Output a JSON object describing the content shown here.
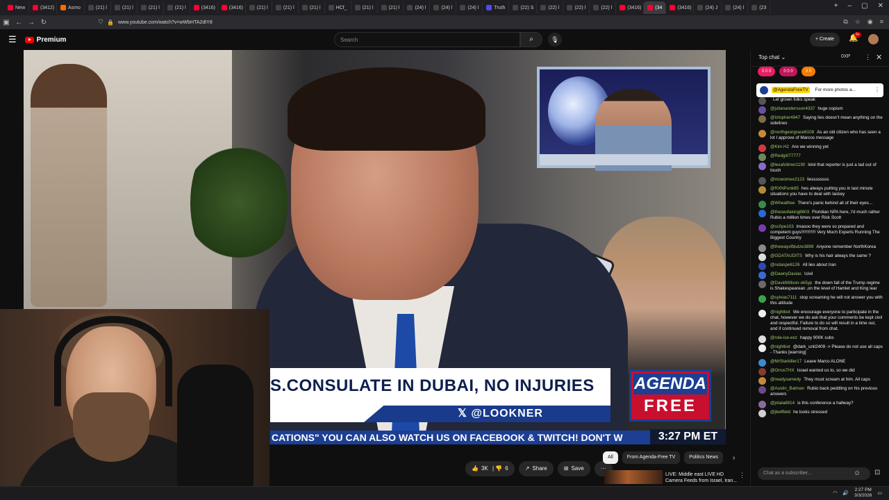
{
  "browser": {
    "tabs": [
      {
        "label": "New",
        "color": "#ff0033"
      },
      {
        "label": "(3412)",
        "color": "#ff0033"
      },
      {
        "label": "Asmo",
        "color": "#ff6b00"
      },
      {
        "label": "(21) l",
        "color": "#444"
      },
      {
        "label": "(21) l",
        "color": "#444"
      },
      {
        "label": "(21) l",
        "color": "#444"
      },
      {
        "label": "(21) l",
        "color": "#444"
      },
      {
        "label": "(3416)",
        "color": "#ff0033"
      },
      {
        "label": "(3416)",
        "color": "#ff0033"
      },
      {
        "label": "(21) l",
        "color": "#444"
      },
      {
        "label": "(21) l",
        "color": "#444"
      },
      {
        "label": "(21) l",
        "color": "#444"
      },
      {
        "label": "HCf_",
        "color": "#444"
      },
      {
        "label": "(21) l",
        "color": "#444"
      },
      {
        "label": "(21) l",
        "color": "#444"
      },
      {
        "label": "(24) l",
        "color": "#444"
      },
      {
        "label": "(24) l",
        "color": "#444"
      },
      {
        "label": "(24) l",
        "color": "#444"
      },
      {
        "label": "Truth",
        "color": "#5448ee"
      },
      {
        "label": "(22) S",
        "color": "#444"
      },
      {
        "label": "(22) l",
        "color": "#444"
      },
      {
        "label": "(22) l",
        "color": "#444"
      },
      {
        "label": "(22) l",
        "color": "#444"
      },
      {
        "label": "(3416)",
        "color": "#ff0033"
      },
      {
        "label": "(34",
        "color": "#ff0033"
      },
      {
        "label": "(3416)",
        "color": "#ff0033"
      },
      {
        "label": "(24) J",
        "color": "#444"
      },
      {
        "label": "(24) l",
        "color": "#444"
      },
      {
        "label": "(23",
        "color": "#444"
      }
    ],
    "active_tab_index": 24,
    "url": "www.youtube.com/watch?v=wWbHTA2dtY8"
  },
  "youtube": {
    "logo": "Premium",
    "search_placeholder": "Search",
    "create_label": "Create",
    "notifications": "9+"
  },
  "video": {
    "headline": "S.CONSULATE IN DUBAI, NO INJURIES",
    "handle": "@LOOKNER",
    "logo_top": "AGENDA",
    "logo_bottom": "FREE",
    "ticker": "CATIONS\"   YOU CAN ALSO WATCH US ON FACEBOOK & TWITCH!   DON'T W",
    "clock": "3:27 PM ET"
  },
  "actions": {
    "likes": "3K",
    "dislikes": "6",
    "share": "Share",
    "save": "Save"
  },
  "chips": [
    "All",
    "From Agenda-Free TV",
    "Politics News"
  ],
  "recommendation": {
    "title": "LIVE: Middle east LIVE HD Camera Feeds from Israel, Iran..."
  },
  "chat": {
    "title": "Top chat",
    "xp": "0XP",
    "tickers": [
      {
        "label": "0  0  0",
        "color": "#e91e63"
      },
      {
        "label": "0  0  0",
        "color": "#c2185b"
      },
      {
        "label": "0  0",
        "color": "#f57c00"
      }
    ],
    "pinned": {
      "name": "@AgendaFreeTV",
      "text": "For more photos a..."
    },
    "messages": [
      {
        "name": "",
        "text": "Let grown folks speak",
        "color": "#555"
      },
      {
        "name": "@julianandersson4337",
        "text": "huge copium",
        "color": "#6a4ea2"
      },
      {
        "name": "@Iztopher4947",
        "text": "Saying lies doesn't mean anything on the sidelines",
        "color": "#7d6b4a"
      },
      {
        "name": "@northgeorgrace6108",
        "text": "As an old citizen who has seen a lot I approve of Marcos message",
        "color": "#c48b3a"
      },
      {
        "name": "@Kim.H2",
        "text": "Are we winning yet",
        "color": "#d23a3a"
      },
      {
        "name": "@Redgirl77777",
        "text": "",
        "color": "#6a8a5a"
      },
      {
        "name": "@lexafollmer1190",
        "text": "lolol that reporter is just a tad out of touch",
        "color": "#8a6ad2"
      },
      {
        "name": "@mcwornex2123",
        "text": "liessssssss",
        "color": "#555"
      },
      {
        "name": "@RXNPunk85",
        "text": "hes always putting you in last minute situations you have to deal with lackey",
        "color": "#b38c3a"
      },
      {
        "name": "@Wheatfree",
        "text": "There's panic behind all of their eyes...",
        "color": "#3a8a4a"
      },
      {
        "name": "@theseofaking8603",
        "text": "Floridian NPA here, I'd much rather Rubio a million times over Rick Scott",
        "color": "#2a6ad2"
      },
      {
        "name": "@sc0pe103",
        "text": "lmaooo they were so prepared and competent guys!!!!!!!!!!!! Very Much Experts Running The Biggest Country",
        "color": "#7a3ab2"
      },
      {
        "name": "@thewayofbiutze3899",
        "text": "Anyone remember NorthKorea",
        "color": "#8a8a8a"
      },
      {
        "name": "@GDATAUDITS",
        "text": "Why is his hair always the same ?",
        "color": "#ddd"
      },
      {
        "name": "@nolaspe6126",
        "text": "All lies about Iran",
        "color": "#2a4ab2"
      },
      {
        "name": "@DawnyDavias",
        "text": "!civil",
        "color": "#3a6ad2"
      },
      {
        "name": "@DavidWilson-ok5yp",
        "text": "the down fall of the Trump regime is Shakespearean ,on the level of Hamlet and King lear",
        "color": "#6a6a6a"
      },
      {
        "name": "@sylvias7111",
        "text": "stop screaming he will not answer you with this attitude",
        "color": "#3aa24a"
      },
      {
        "name": "@nightbot",
        "text": "We encourage everyone to participate in the chat, however we do ask that your comments be kept civil and respectful. Failure to do so will result in a time out, and if continued removal from chat.",
        "color": "#eee"
      },
      {
        "name": "@role-ice-exz",
        "text": "happy 900K subs",
        "color": "#ddd"
      },
      {
        "name": "@nightbot",
        "text": "@dark_unit2409 -> Please do not use all caps - Thanks [warning]",
        "color": "#eee"
      },
      {
        "name": "@MrStarkiller17",
        "text": "Leave Marco ALONE",
        "color": "#3a8ad2"
      },
      {
        "name": "@OrrusTHX",
        "text": "Israel wanted us to, so we did",
        "color": "#8a3a2a"
      },
      {
        "name": "@readysamedy",
        "text": "They must scream at him. All caps",
        "color": "#c28a3a"
      },
      {
        "name": "@Austin_Batman",
        "text": "Rubio back peddling on his previous answers",
        "color": "#6a4a8a"
      },
      {
        "name": "@jnlala8814",
        "text": "is this conference a hallway?",
        "color": "#8a6a9a"
      },
      {
        "name": "@jbellfield",
        "text": "he looks stressed",
        "color": "#cfcfcf"
      }
    ],
    "input_placeholder": "Chat as a subscriber..."
  },
  "taskbar": {
    "time": "2:27 PM",
    "date": "3/3/2026"
  }
}
